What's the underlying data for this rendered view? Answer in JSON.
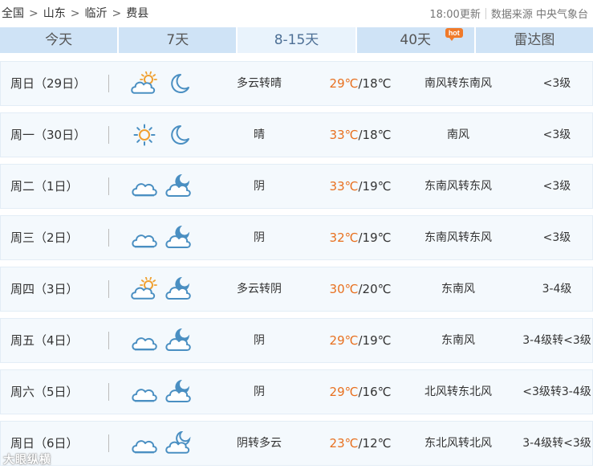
{
  "breadcrumb": [
    "全国",
    "山东",
    "临沂",
    "费县"
  ],
  "breadcrumb_separator": ">",
  "meta": {
    "update_time": "18:00更新",
    "source_label": "数据来源",
    "source_name": "中央气象台"
  },
  "tabs": [
    {
      "label": "今天",
      "active": false,
      "badge": ""
    },
    {
      "label": "7天",
      "active": false,
      "badge": ""
    },
    {
      "label": "8-15天",
      "active": true,
      "badge": ""
    },
    {
      "label": "40天",
      "active": false,
      "badge": "hot"
    },
    {
      "label": "雷达图",
      "active": false,
      "badge": ""
    }
  ],
  "colors": {
    "tab_bg": "#cfe3f6",
    "tab_active_bg": "#e9f3fc",
    "row_bg": "#f4f9fd",
    "high_temp": "#e8701f",
    "icon_stroke": "#4a8fc2",
    "sun": "#f0a030",
    "hot_badge": "#f07a2a"
  },
  "forecast": [
    {
      "day": "周日（29日）",
      "day_icon": "partly-cloudy-icon",
      "night_icon": "moon-icon",
      "condition": "多云转晴",
      "high": "29℃",
      "low": "/18℃",
      "wind": "南风转东南风",
      "level": "<3级"
    },
    {
      "day": "周一（30日）",
      "day_icon": "sun-icon",
      "night_icon": "moon-icon",
      "condition": "晴",
      "high": "33℃",
      "low": "/18℃",
      "wind": "南风",
      "level": "<3级"
    },
    {
      "day": "周二（1日）",
      "day_icon": "cloud-icon",
      "night_icon": "cloudy-night-icon",
      "condition": "阴",
      "high": "33℃",
      "low": "/19℃",
      "wind": "东南风转东风",
      "level": "<3级"
    },
    {
      "day": "周三（2日）",
      "day_icon": "cloud-icon",
      "night_icon": "cloudy-night-icon",
      "condition": "阴",
      "high": "32℃",
      "low": "/19℃",
      "wind": "东南风转东风",
      "level": "<3级"
    },
    {
      "day": "周四（3日）",
      "day_icon": "partly-cloudy-icon",
      "night_icon": "cloudy-night-icon",
      "condition": "多云转阴",
      "high": "30℃",
      "low": "/20℃",
      "wind": "东南风",
      "level": "3-4级"
    },
    {
      "day": "周五（4日）",
      "day_icon": "cloud-icon",
      "night_icon": "cloudy-night-icon",
      "condition": "阴",
      "high": "29℃",
      "low": "/19℃",
      "wind": "东南风",
      "level": "3-4级转<3级"
    },
    {
      "day": "周六（5日）",
      "day_icon": "cloud-icon",
      "night_icon": "cloudy-night-icon",
      "condition": "阴",
      "high": "29℃",
      "low": "/16℃",
      "wind": "北风转东北风",
      "level": "<3级转3-4级"
    },
    {
      "day": "周日（6日）",
      "day_icon": "cloud-icon",
      "night_icon": "partly-cloudy-night-icon",
      "condition": "阴转多云",
      "high": "23℃",
      "low": "/12℃",
      "wind": "东北风转北风",
      "level": "3-4级转<3级"
    }
  ],
  "watermark": "大眼纵横"
}
